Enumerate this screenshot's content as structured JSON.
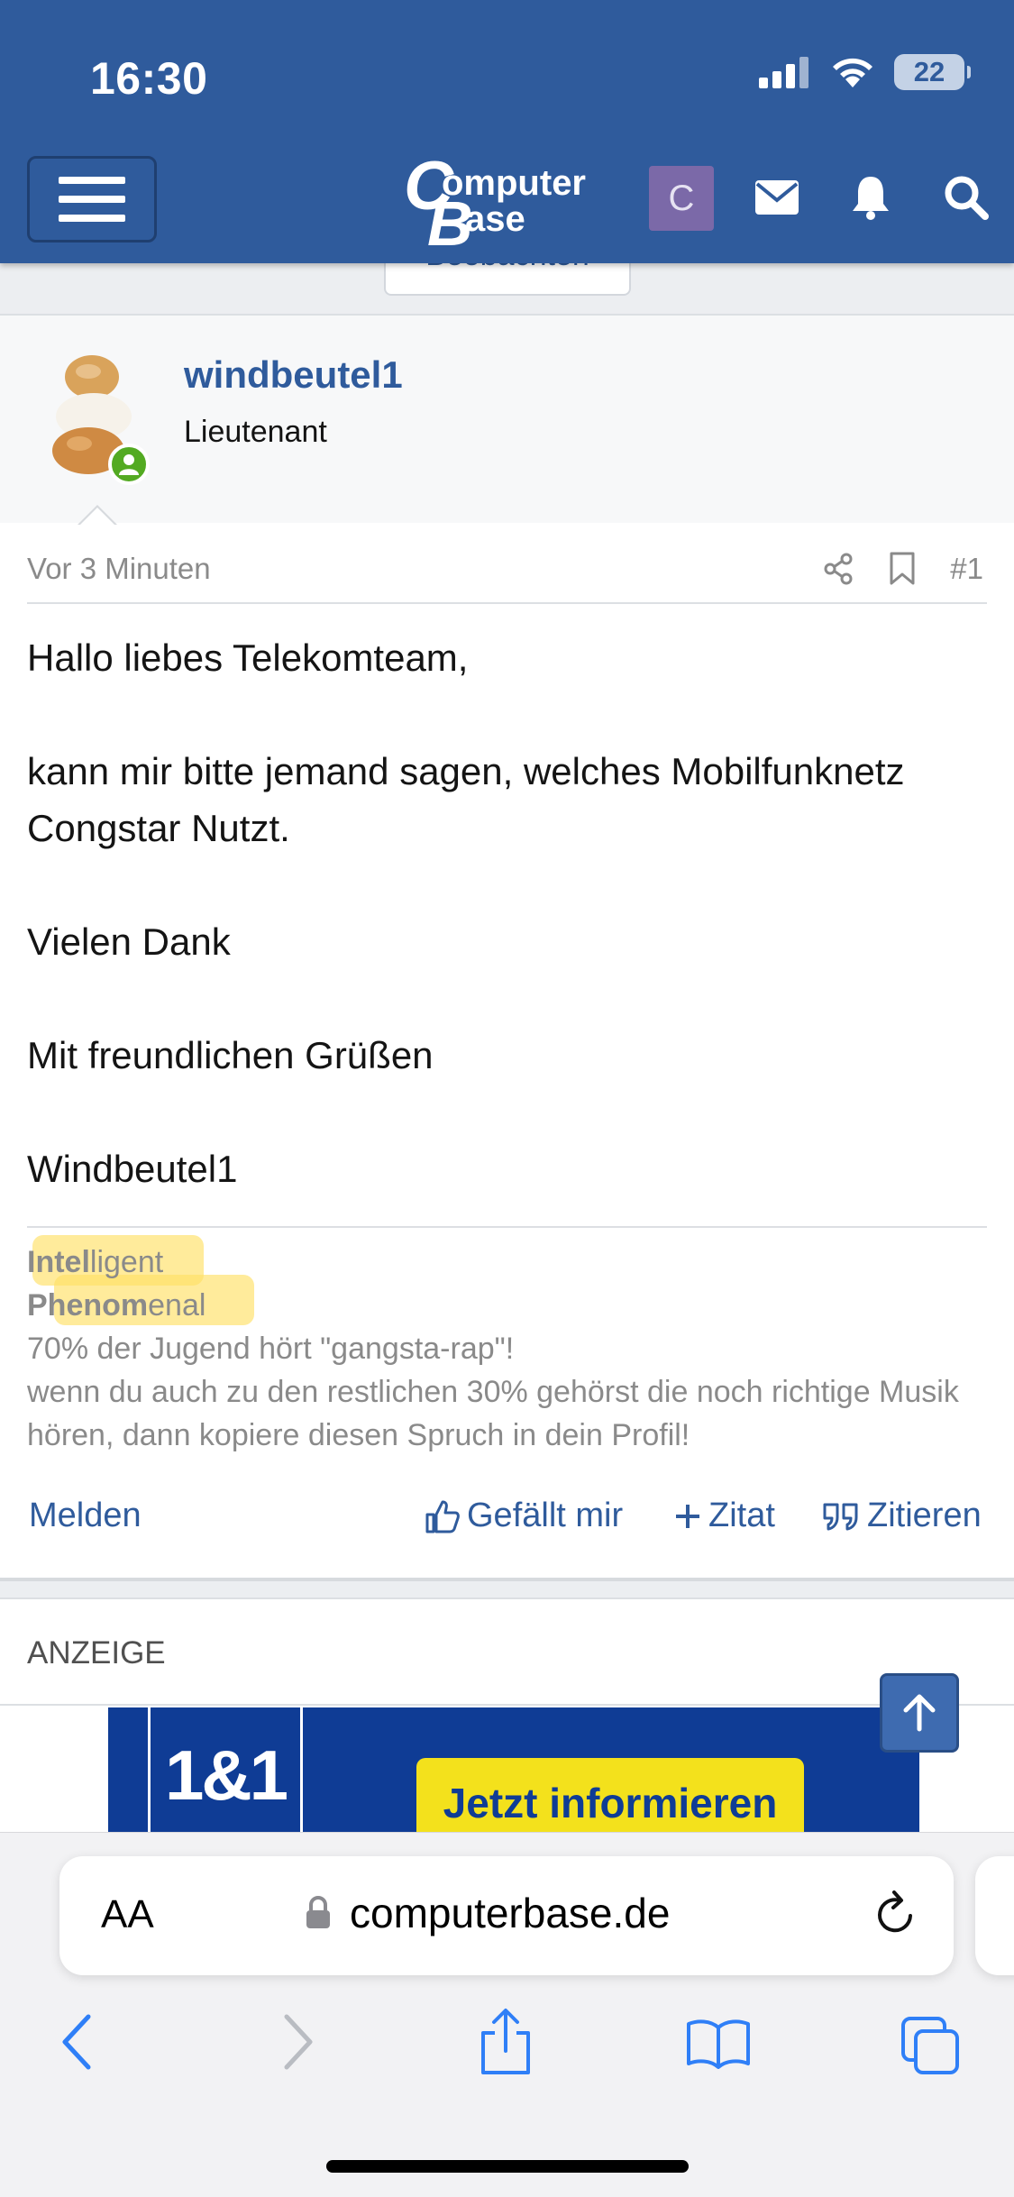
{
  "status_bar": {
    "time": "16:30",
    "battery": "22",
    "icons": [
      "cellular-signal-icon",
      "wifi-icon",
      "battery-icon"
    ]
  },
  "header": {
    "logo_text": "ComputerBase",
    "avatar_letter": "C",
    "icons": [
      "menu-icon",
      "mail-icon",
      "bell-icon",
      "search-icon"
    ],
    "colors": {
      "bar": "#2f5b9c",
      "avatar": "#7b69a8"
    }
  },
  "watch_button": {
    "label": "Beobachten"
  },
  "user": {
    "name": "windbeutel1",
    "title": "Lieutenant",
    "online": true,
    "status_color": "#53aa22"
  },
  "post": {
    "time": "Vor 3 Minuten",
    "number": "#1",
    "paragraphs": [
      "Hallo liebes Telekomteam,",
      "kann mir bitte jemand sagen, welches Mobilfunknetz Congstar Nutzt.",
      "Vielen Dank",
      "Mit freundlichen Grüßen",
      "Windbeutel1"
    ],
    "signature": {
      "line1_bold": "Intel",
      "line1_rest": "ligent",
      "line2_bold": "Phenom",
      "line2_rest": "enal",
      "line3": "70% der Jugend hört \"gangsta-rap\"!",
      "line4": "wenn du auch zu den restlichen 30% gehörst die noch richtige Musik hören, dann kopiere diesen Spruch in dein Profil!"
    },
    "actions": {
      "report": "Melden",
      "like": "Gefällt mir",
      "quote_add": "Zitat",
      "quote": "Zitieren"
    }
  },
  "ad": {
    "label": "ANZEIGE",
    "brand": "1&1",
    "cta": "Jetzt informieren",
    "colors": {
      "bg": "#0f3c95",
      "cta": "#f3e11c"
    }
  },
  "browser": {
    "aa_label": "AA",
    "url": "computerbase.de",
    "toolbar": [
      "back-icon",
      "forward-icon",
      "share-icon",
      "bookmarks-icon",
      "tabs-icon"
    ]
  }
}
